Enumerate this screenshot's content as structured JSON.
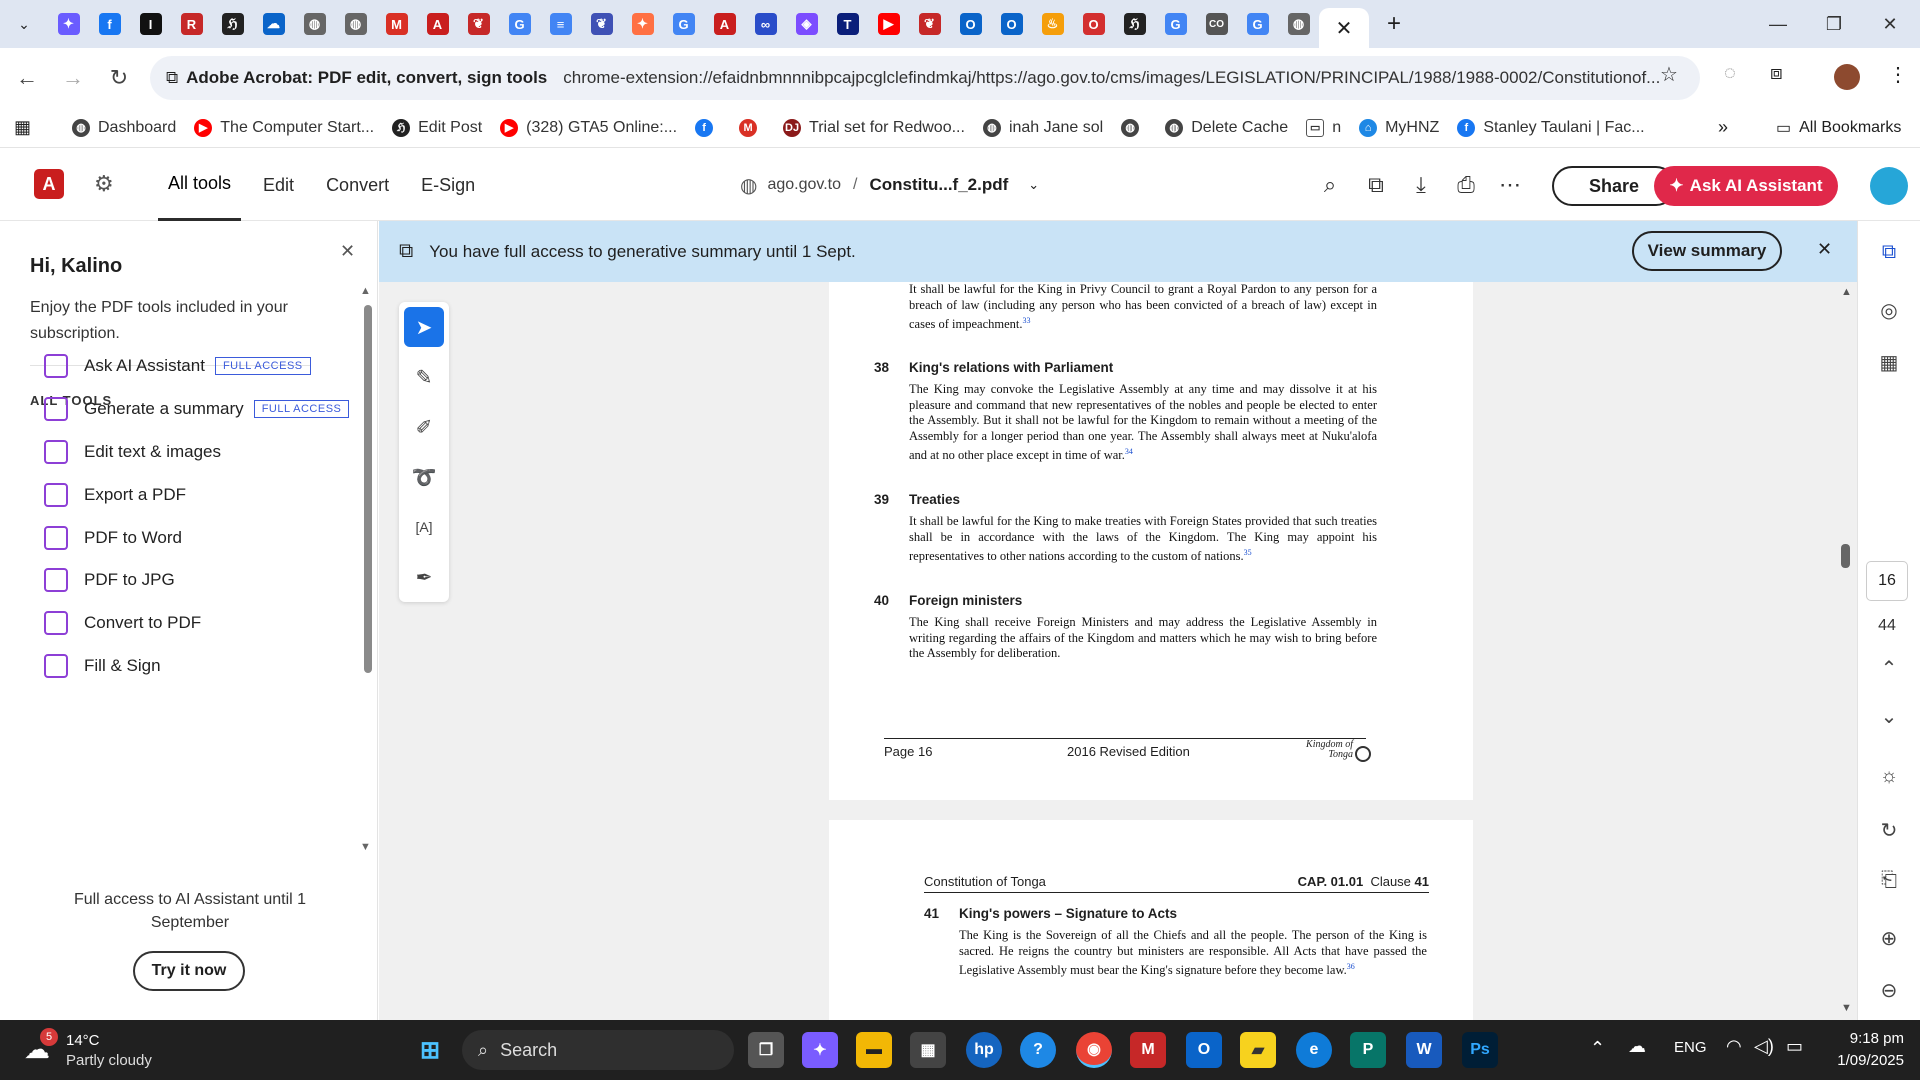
{
  "browser": {
    "tabs_favicons": [
      {
        "icon": "copilot-icon",
        "color": "#6a5cff",
        "glyph": "✦"
      },
      {
        "icon": "facebook-icon",
        "color": "#1877f2",
        "glyph": "f"
      },
      {
        "icon": "imdb-icon",
        "color": "#111",
        "glyph": "I"
      },
      {
        "icon": "red-app-icon",
        "color": "#c62828",
        "glyph": "R"
      },
      {
        "icon": "news-icon",
        "color": "#222",
        "glyph": "ℌ"
      },
      {
        "icon": "onedrive-icon",
        "color": "#0a64c9",
        "glyph": "☁"
      },
      {
        "icon": "globe-icon",
        "color": "#666",
        "glyph": "◍"
      },
      {
        "icon": "globe-icon",
        "color": "#666",
        "glyph": "◍"
      },
      {
        "icon": "gmail-icon",
        "color": "#d93025",
        "glyph": "M"
      },
      {
        "icon": "acrobat-icon",
        "color": "#c91e1e",
        "glyph": "A"
      },
      {
        "icon": "book-icon",
        "color": "#c62828",
        "glyph": "❦"
      },
      {
        "icon": "google-icon",
        "color": "#4285f4",
        "glyph": "G"
      },
      {
        "icon": "docs-icon",
        "color": "#4285f4",
        "glyph": "≡"
      },
      {
        "icon": "bird-icon",
        "color": "#3f51b5",
        "glyph": "❦"
      },
      {
        "icon": "copilot-icon",
        "color": "#ff7043",
        "glyph": "✦"
      },
      {
        "icon": "google-icon",
        "color": "#4285f4",
        "glyph": "G"
      },
      {
        "icon": "acrobat-icon",
        "color": "#c91e1e",
        "glyph": "A"
      },
      {
        "icon": "stream-icon",
        "color": "#2a4dc9",
        "glyph": "∞"
      },
      {
        "icon": "shield-icon",
        "color": "#7c4dff",
        "glyph": "◈"
      },
      {
        "icon": "t-icon",
        "color": "#0b1f7a",
        "glyph": "T"
      },
      {
        "icon": "youtube-icon",
        "color": "#ff0000",
        "glyph": "▶"
      },
      {
        "icon": "book-icon",
        "color": "#c62828",
        "glyph": "❦"
      },
      {
        "icon": "outlook-icon",
        "color": "#0a64c9",
        "glyph": "O"
      },
      {
        "icon": "outlook-icon",
        "color": "#0a64c9",
        "glyph": "O"
      },
      {
        "icon": "flame-icon",
        "color": "#f59e0b",
        "glyph": "♨"
      },
      {
        "icon": "red-o-icon",
        "color": "#d32f2f",
        "glyph": "O"
      },
      {
        "icon": "news-icon",
        "color": "#222",
        "glyph": "ℌ"
      },
      {
        "icon": "google-icon",
        "color": "#4285f4",
        "glyph": "G"
      },
      {
        "icon": "co-icon",
        "color": "#555",
        "glyph": "CO"
      },
      {
        "icon": "google-icon",
        "color": "#4285f4",
        "glyph": "G"
      },
      {
        "icon": "globe-icon",
        "color": "#666",
        "glyph": "◍"
      }
    ],
    "site_name": "Adobe Acrobat: PDF edit, convert, sign tools",
    "url": "chrome-extension://efaidnbmnnnibpcajpcglclefindmkaj/https://ago.gov.to/cms/images/LEGISLATION/PRINCIPAL/1988/1988-0002/Constitutionof...",
    "bookmarks": [
      {
        "label": "Dashboard",
        "color": "#444",
        "glyph": "◍"
      },
      {
        "label": "The Computer Start...",
        "color": "#ff0000",
        "glyph": "▶"
      },
      {
        "label": "Edit Post",
        "color": "#222",
        "glyph": "ℌ"
      },
      {
        "label": "(328) GTA5 Online:...",
        "color": "#ff0000",
        "glyph": "▶"
      },
      {
        "label": "",
        "color": "#1877f2",
        "glyph": "f"
      },
      {
        "label": "",
        "color": "#d93025",
        "glyph": "M"
      },
      {
        "label": "Trial set for Redwoo...",
        "color": "#8b1a1a",
        "glyph": "DJ"
      },
      {
        "label": "inah Jane sol",
        "color": "#444",
        "glyph": "◍"
      },
      {
        "label": "",
        "color": "#444",
        "glyph": "◍"
      },
      {
        "label": "Delete Cache",
        "color": "#444",
        "glyph": "◍"
      },
      {
        "label": "n",
        "color": "#fff",
        "glyph": "▭"
      },
      {
        "label": "MyHNZ",
        "color": "#1e88e5",
        "glyph": "⌂"
      },
      {
        "label": "Stanley Taulani | Fac...",
        "color": "#1877f2",
        "glyph": "f"
      }
    ],
    "all_bookmarks": "All Bookmarks"
  },
  "acrobat": {
    "logo": "A",
    "nav": [
      "All tools",
      "Edit",
      "Convert",
      "E-Sign"
    ],
    "domain": "ago.gov.to",
    "separator": "/",
    "filename": "Constitu...f_2.pdf",
    "share": "Share",
    "ai_button": "Ask AI Assistant"
  },
  "panel": {
    "greeting": "Hi, Kalino",
    "subtitle": "Enjoy the PDF tools included in your subscription.",
    "section": "ALL TOOLS",
    "tools": [
      {
        "label": "Ask AI Assistant",
        "badge": "FULL ACCESS"
      },
      {
        "label": "Generate a summary",
        "badge": "FULL ACCESS"
      },
      {
        "label": "Edit text & images",
        "badge": ""
      },
      {
        "label": "Export a PDF",
        "badge": ""
      },
      {
        "label": "PDF to Word",
        "badge": ""
      },
      {
        "label": "PDF to JPG",
        "badge": ""
      },
      {
        "label": "Convert to PDF",
        "badge": ""
      },
      {
        "label": "Fill & Sign",
        "badge": ""
      }
    ],
    "footer": "Full access to AI Assistant until 1 September",
    "try_button": "Try it now"
  },
  "banner": {
    "text": "You have full access to generative summary until 1 Sept.",
    "button": "View summary"
  },
  "document": {
    "p1": {
      "intro": "It shall be lawful for the King in Privy Council to grant a Royal Pardon to any person for a breach of law (including any person who has been convicted of a breach of law) except in cases of impeachment.",
      "intro_fn": "33",
      "sections": [
        {
          "num": "38",
          "title": "King's relations with Parliament",
          "body": "The King may convoke the Legislative Assembly at any time and may dissolve it at his pleasure and command that new representatives of the nobles and people be elected to enter the Assembly. But it shall not be lawful for the Kingdom to remain without a meeting of the Assembly for a longer period than one year. The Assembly shall always meet at Nuku'alofa and at no other place except in time of war.",
          "fn": "34"
        },
        {
          "num": "39",
          "title": "Treaties",
          "body": "It shall be lawful for the King to make treaties with Foreign States provided that such treaties shall be in accordance with the laws of the Kingdom. The King may appoint his representatives to other nations according to the custom of nations.",
          "fn": "35"
        },
        {
          "num": "40",
          "title": "Foreign ministers",
          "body": "The King shall receive Foreign Ministers and may address the Legislative Assembly in writing regarding the affairs of the Kingdom and matters which he may wish to bring before the Assembly for deliberation.",
          "fn": ""
        }
      ],
      "footer_page": "Page 16",
      "footer_edition": "2016 Revised Edition",
      "footer_seal": "Kingdom of Tonga"
    },
    "p2": {
      "header_left": "Constitution of Tonga",
      "header_cap": "CAP. 01.01",
      "header_clause": "Clause",
      "header_clause_num": "41",
      "sections": [
        {
          "num": "41",
          "title": "King's powers – Signature to Acts",
          "body": "The King is the Sovereign of all the Chiefs and all the people. The person of the King is sacred. He reigns the country but ministers are responsible. All Acts that have passed the Legislative Assembly must bear the King's signature before they become law.",
          "fn": "36"
        }
      ]
    }
  },
  "page_nav": {
    "current": "16",
    "total": "44"
  },
  "taskbar": {
    "weather_badge": "5",
    "temperature": "14°C",
    "condition": "Partly cloudy",
    "search": "Search",
    "language": "ENG",
    "time": "9:18 pm",
    "date": "1/09/2025"
  }
}
